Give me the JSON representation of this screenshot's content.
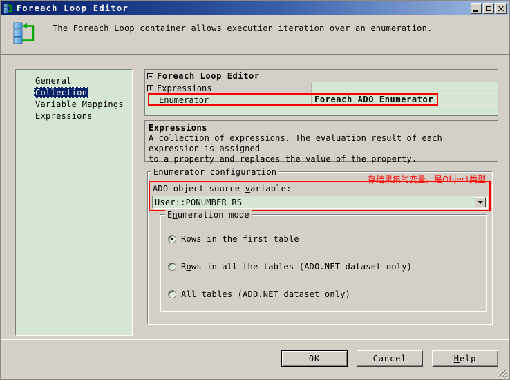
{
  "window": {
    "title": "Foreach Loop Editor",
    "icon": "foreach-loop-icon",
    "minimize_label": "Minimize",
    "maximize_label": "Maximize",
    "close_label": "Close"
  },
  "banner": {
    "icon": "foreach-loop-large-icon",
    "description": "The Foreach Loop container allows execution iteration over an enumeration."
  },
  "sidebar": {
    "items": [
      {
        "label": "General",
        "selected": false
      },
      {
        "label": "Collection",
        "selected": true
      },
      {
        "label": "Variable Mappings",
        "selected": false
      },
      {
        "label": "Expressions",
        "selected": false
      }
    ]
  },
  "property_grid": {
    "header": "Foreach Loop Editor",
    "header_expander": "minus-box-icon",
    "rows": [
      {
        "name": "Expressions",
        "value": "",
        "expander": "plus-box-icon",
        "bold_value": false,
        "highlighted": false
      },
      {
        "name": "Enumerator",
        "value": "Foreach ADO Enumerator",
        "expander": "",
        "bold_value": true,
        "highlighted": true
      }
    ]
  },
  "description_pane": {
    "title": "Expressions",
    "line1": "A collection of expressions. The evaluation result of each expression is assigned",
    "line2": "to a property and replaces the value of the property."
  },
  "enumerator_configuration": {
    "legend": "Enumerator configuration",
    "annotation_cn": "存结果集的变量，是Object类型",
    "annotation_color": "#ff0000",
    "ado_variable_label_pre": "ADO object source ",
    "ado_variable_label_accel": "v",
    "ado_variable_label_post": "ariable:",
    "ado_variable_value": "User::PONUMBER_RS",
    "dropdown_icon": "chevron-down-icon",
    "enumeration_mode": {
      "legend_pre": "E",
      "legend_accel": "n",
      "legend_post": "umeration mode",
      "options": [
        {
          "pre": "R",
          "accel": "o",
          "post": "ws in the first table",
          "checked": true
        },
        {
          "pre": "R",
          "accel": "o",
          "post": "ws in all the tables (ADO.NET dataset only)",
          "checked": false
        },
        {
          "pre": "",
          "accel": "A",
          "post": "ll tables (ADO.NET dataset only)",
          "checked": false
        }
      ]
    }
  },
  "footer": {
    "ok": "OK",
    "cancel": "Cancel",
    "help_accel": "H",
    "help_post": "elp",
    "resize_grip": "resize-grip-icon"
  },
  "colors": {
    "dialog_face": "#d4d0c8",
    "field_green": "#d3e7d3",
    "selection_blue": "#0a246a",
    "annotation_red": "#ff0000",
    "title_gradient_start": "#0a246a",
    "title_gradient_end": "#a6c0e6"
  }
}
